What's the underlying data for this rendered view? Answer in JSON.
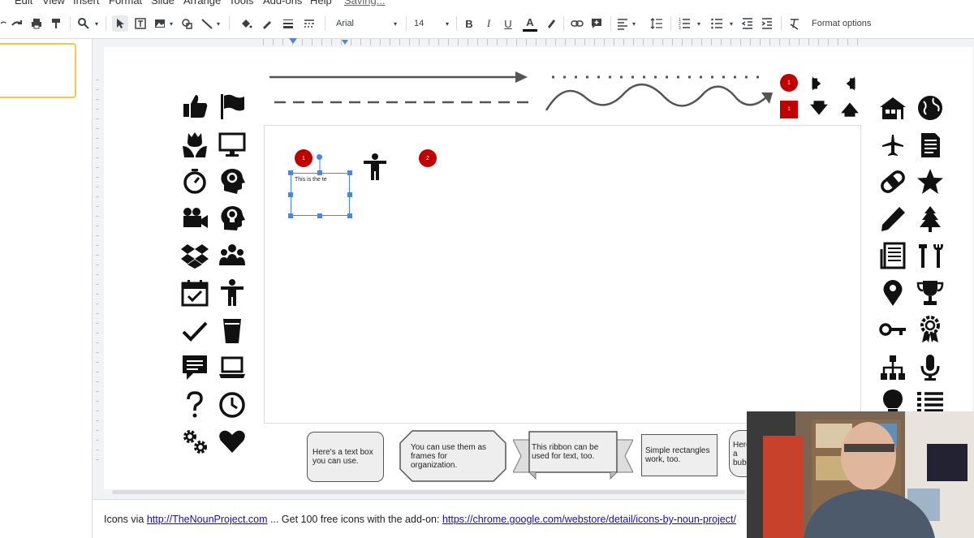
{
  "menu": {
    "items": [
      "Edit",
      "View",
      "Insert",
      "Format",
      "Slide",
      "Arrange",
      "Tools",
      "Add-ons",
      "Help",
      "Saving..."
    ]
  },
  "toolbar": {
    "font": "Arial",
    "font_size": "14",
    "format_options": "Format options"
  },
  "canvas": {
    "badge_1": "1",
    "badge_2": "2",
    "textbox_text": "This is the te"
  },
  "header_badges": {
    "circle": "1",
    "square": "1"
  },
  "shapes": {
    "rounded": "Here's a text box you can use.",
    "octagon": "You can use them as frames for organization.",
    "ribbon": "This ribbon can be used for text, too.",
    "rect": "Simple rectangles work, too.",
    "bubble": "Here's a bubble"
  },
  "footer": {
    "prefix": "Icons via",
    "link1": "http://TheNounProject.com",
    "middle": "... Get 100 free icons with the add-on:",
    "link2": "https://chrome.google.com/webstore/detail/icons-by-noun-project/"
  },
  "colors": {
    "accent_red": "#c00000",
    "selection_blue": "#4a86e8",
    "thumb_border": "#f2c94c"
  },
  "icons_left": [
    "thumbs-up-icon",
    "flag-icon",
    "tulip-icon",
    "monitor-icon",
    "stopwatch-icon",
    "head-gear-icon",
    "video-camera-icon",
    "head-lightbulb-icon",
    "dropbox-icon",
    "group-icon",
    "calendar-check-icon",
    "person-icon",
    "checkmark-icon",
    "cup-icon",
    "chat-icon",
    "laptop-icon",
    "question-mark-icon",
    "clock-icon",
    "gears-icon",
    "heart-icon"
  ],
  "icons_right": [
    "house-icon",
    "globe-icon",
    "airplane-icon",
    "document-icon",
    "bandage-icon",
    "star-icon",
    "pencil-icon",
    "tree-icon",
    "newspaper-icon",
    "tools-icon",
    "map-pin-icon",
    "trophy-icon",
    "key-icon",
    "award-icon",
    "org-chart-icon",
    "microphone-icon",
    "lightbulb-icon",
    "list-icon"
  ]
}
